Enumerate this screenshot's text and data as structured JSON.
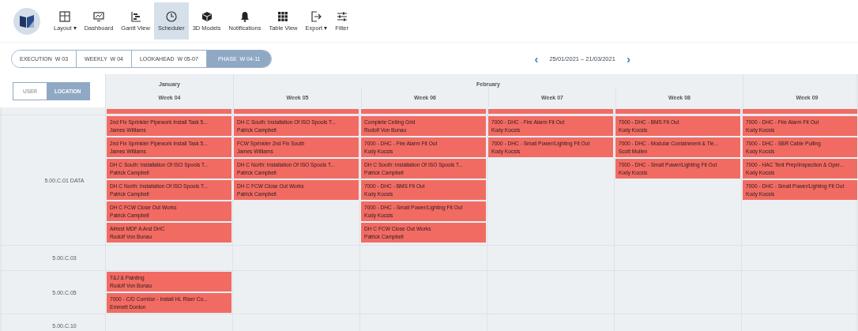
{
  "toolbar": [
    {
      "label": "Layout",
      "caret": "▾",
      "selected": false
    },
    {
      "label": "Dashboard",
      "selected": false
    },
    {
      "label": "Gantt View",
      "selected": false
    },
    {
      "label": "Scheduler",
      "selected": true
    },
    {
      "label": "3D Models",
      "selected": false
    },
    {
      "label": "Notifications",
      "selected": false
    },
    {
      "label": "Table View",
      "selected": false
    },
    {
      "label": "Export",
      "caret": "▾",
      "selected": false
    },
    {
      "label": "Filter",
      "selected": false
    }
  ],
  "phases": [
    {
      "label": "EXECUTION",
      "weeks": "W 03",
      "selected": false
    },
    {
      "label": "WEEKLY",
      "weeks": "W 04",
      "selected": false
    },
    {
      "label": "LOOKAHEAD",
      "weeks": "W 05-07",
      "selected": false
    },
    {
      "label": "PHASE",
      "weeks": "W 04-11",
      "selected": true
    }
  ],
  "date_nav": {
    "prev": "‹",
    "range": "25/01/2021 – 21/03/2021",
    "next": "›"
  },
  "view_toggle": [
    {
      "label": "USER",
      "selected": false
    },
    {
      "label": "LOCATION",
      "selected": true
    }
  ],
  "months": [
    {
      "label": "January",
      "weeks": [
        "Week 04"
      ]
    },
    {
      "label": "February",
      "weeks": [
        "Week 05",
        "Week 06",
        "Week 07",
        "Week 08"
      ]
    },
    {
      "weeks": [
        "Week 09"
      ]
    }
  ],
  "locations": [
    {
      "name": "5.00.C.01 DATA",
      "cells": [
        [
          {
            "title": "2nd Fix Sprinkler Pipework Install Task 5...",
            "assignee": "James Williams"
          },
          {
            "title": "2nd Fix Sprinkler Pipework Install Task 5...",
            "assignee": "James Williams"
          },
          {
            "title": "DH C South: Installation Of ISO Spools T...",
            "assignee": "Patrick Campbell"
          },
          {
            "title": "DH C North: Installation Of ISO Spools T...",
            "assignee": "Patrick Campbell"
          },
          {
            "title": "DH C FCW Close Out Works",
            "assignee": "Patrick Campbell"
          },
          {
            "title": "Airtest MDF A And DHC",
            "assignee": "Rudolf Von Bunau"
          }
        ],
        [
          {
            "title": "DH C South: Installation Of ISO Spools T...",
            "assignee": "Patrick Campbell"
          },
          {
            "title": "FCW Sprinkler 2nd Fix South",
            "assignee": "James Williams"
          },
          {
            "title": "DH C North: Installation Of ISO Spools T...",
            "assignee": "Patrick Campbell"
          },
          {
            "title": "DH C FCW Close Out Works",
            "assignee": "Patrick Campbell"
          }
        ],
        [
          {
            "title": "Complete Ceiling Grid",
            "assignee": "Rudolf Von Bunau"
          },
          {
            "title": "7000 - DHC - Fire Alarm Fit Out",
            "assignee": "Kody Kocsis"
          },
          {
            "title": "DH C South: Installation Of ISO Spools T...",
            "assignee": "Patrick Campbell"
          },
          {
            "title": "7000 - DHC - BMS Fit Out",
            "assignee": "Kody Kocsis"
          },
          {
            "title": "7000 - DHC - Small Power/Lighting Fit Out",
            "assignee": "Kody Kocsis"
          },
          {
            "title": "DH C FCW Close Out Works",
            "assignee": "Patrick Campbell"
          }
        ],
        [
          {
            "title": "7000 - DHC - Fire Alarm Fit Out",
            "assignee": "Kody Kocsis"
          },
          {
            "title": "7000 - DHC - Small Power/Lighting Fit Out",
            "assignee": "Kody Kocsis"
          }
        ],
        [
          {
            "title": "7000 - DHC - BMS Fit Out",
            "assignee": "Kody Kocsis"
          },
          {
            "title": "7000 - DHC - Modular Containment & Tie...",
            "assignee": "Scott Mullen"
          },
          {
            "title": "7000 - DHC - Small Power/Lighting Fit Out",
            "assignee": "Kody Kocsis"
          }
        ],
        [
          {
            "title": "7000 - DHC - Fire Alarm Fit Out",
            "assignee": "Kody Kocsis"
          },
          {
            "title": "7000 - DHC - SBR Cable Pulling",
            "assignee": "Kody Kocsis"
          },
          {
            "title": "7000 - HAC Tent Prep/Inspection & Oper...",
            "assignee": "Kody Kocsis"
          },
          {
            "title": "7000 - DHC - Small Power/Lighting Fit Out",
            "assignee": "Kody Kocsis"
          }
        ]
      ]
    },
    {
      "name": "5.00.C.03",
      "cells": [
        [],
        [],
        [],
        [],
        [],
        []
      ]
    },
    {
      "name": "5.00.C.05",
      "cells": [
        [
          {
            "title": "T&J & Painting",
            "assignee": "Rudolf Von Bunau"
          },
          {
            "title": "7000 - C/D Corridor - Install HL Riser Co...",
            "assignee": "Emmett Donlon"
          }
        ],
        [],
        [],
        [],
        [],
        []
      ]
    },
    {
      "name": "5.00.C.10",
      "cells": [
        [],
        [],
        [],
        [],
        [],
        []
      ]
    }
  ]
}
